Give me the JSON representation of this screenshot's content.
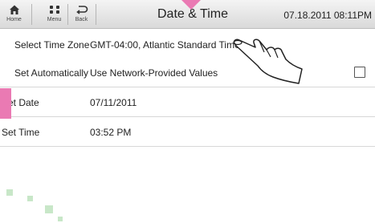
{
  "header": {
    "title": "Date & Time",
    "datetime": "07.18.2011 08:11PM",
    "buttons": [
      {
        "label": "Home",
        "icon": "home-icon"
      },
      {
        "label": "Menu",
        "icon": "menu-grid-icon"
      },
      {
        "label": "Back",
        "icon": "back-arrow-icon"
      }
    ]
  },
  "settings": [
    {
      "label": "Select Time Zone",
      "value": "GMT-04:00, Atlantic Standard Time"
    },
    {
      "label": "Set Automatically",
      "value": "Use Network-Provided Values",
      "checked": false
    },
    {
      "label": "Set Date",
      "value": "07/11/2011"
    },
    {
      "label": "Set Time",
      "value": "03:52 PM"
    }
  ],
  "colors": {
    "accent": "#ea7ab3",
    "decor_green": "#9bd49b"
  }
}
